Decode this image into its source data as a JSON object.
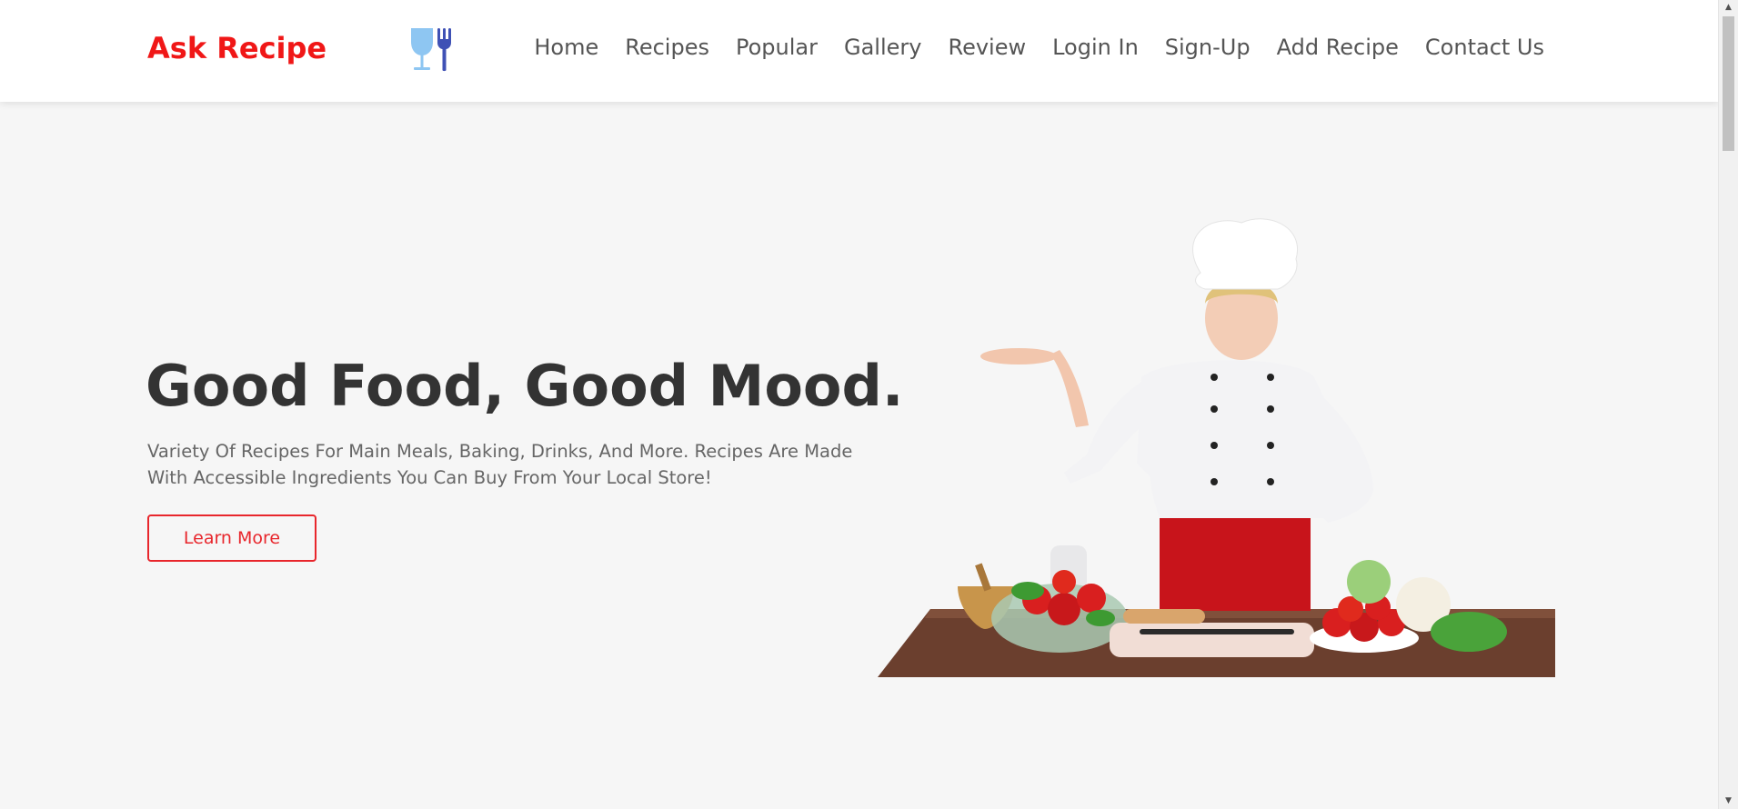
{
  "header": {
    "logo_text": "Ask Recipe",
    "logo_icon": "glass-and-fork-icon",
    "nav": [
      {
        "label": "Home"
      },
      {
        "label": "Recipes"
      },
      {
        "label": "Popular"
      },
      {
        "label": "Gallery"
      },
      {
        "label": "Review"
      },
      {
        "label": "Login In"
      },
      {
        "label": "Sign-Up"
      },
      {
        "label": "Add Recipe"
      },
      {
        "label": "Contact Us"
      }
    ]
  },
  "hero": {
    "title": "Good Food, Good Mood.",
    "subtitle": "Variety Of Recipes For Main Meals, Baking, Drinks, And More. Recipes Are Made With Accessible Ingredients You Can Buy From Your Local Store!",
    "button_label": "Learn More",
    "image": "chef-with-vegetables-illustration"
  },
  "colors": {
    "brand": "#f01717",
    "accent_button": "#e8262c",
    "page_bg": "#f6f6f6",
    "header_bg": "#ffffff",
    "nav_text": "#555555",
    "title_text": "#333333",
    "icon_glass": "#8ec6f2",
    "icon_fork": "#3f51b5"
  }
}
